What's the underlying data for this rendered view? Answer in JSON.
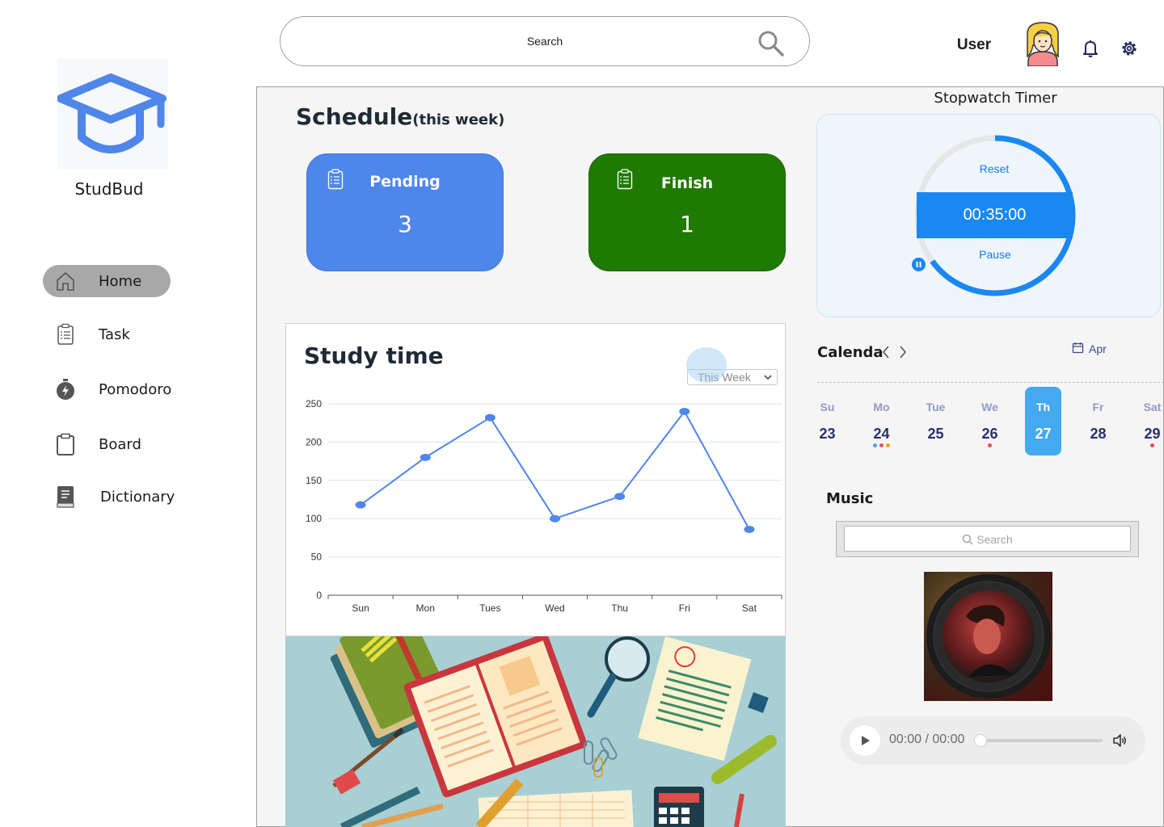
{
  "app": {
    "name": "StudBud"
  },
  "sidebar": {
    "items": [
      {
        "label": "Home",
        "icon": "home-icon",
        "active": true
      },
      {
        "label": "Task",
        "icon": "clipboard-icon"
      },
      {
        "label": "Pomodoro",
        "icon": "stopwatch-icon"
      },
      {
        "label": "Board",
        "icon": "board-icon"
      },
      {
        "label": "Dictionary",
        "icon": "book-icon"
      }
    ]
  },
  "header": {
    "search_placeholder": "Search",
    "user_name": "User"
  },
  "schedule": {
    "title": "Schedule",
    "subtitle": "(this week)",
    "pending": {
      "label": "Pending",
      "value": "3"
    },
    "finish": {
      "label": "Finish",
      "value": "1"
    }
  },
  "study_time": {
    "title": "Study time",
    "period_select": "This Week"
  },
  "chart_data": {
    "type": "line",
    "title": "Study time",
    "categories": [
      "Sun",
      "Mon",
      "Tues",
      "Wed",
      "Thu",
      "Fri",
      "Sat"
    ],
    "series": [
      {
        "values": [
          118,
          180,
          232,
          100,
          129,
          240,
          86
        ]
      }
    ],
    "ylim": [
      0,
      250
    ],
    "yticks": [
      0,
      50,
      100,
      150,
      200,
      250
    ],
    "grid": true,
    "color": "#4f86ea"
  },
  "stopwatch": {
    "title": "Stopwatch Timer",
    "reset_label": "Reset",
    "time": "00:35:00",
    "pause_label": "Pause",
    "progress": 0.65
  },
  "calendar": {
    "title": "Calenda",
    "month": "Apr",
    "days": [
      {
        "name": "Su",
        "num": "23",
        "dots": []
      },
      {
        "name": "Mo",
        "num": "24",
        "dots": [
          "#4fa3f0",
          "#e84c5a",
          "#f0a020"
        ]
      },
      {
        "name": "Tue",
        "num": "25",
        "dots": []
      },
      {
        "name": "We",
        "num": "26",
        "dots": [
          "#e84c5a"
        ]
      },
      {
        "name": "Th",
        "num": "27",
        "dots": [],
        "selected": true
      },
      {
        "name": "Fr",
        "num": "28",
        "dots": []
      },
      {
        "name": "Sat",
        "num": "29",
        "dots": [
          "#e84c5a"
        ]
      }
    ]
  },
  "music": {
    "title": "Music",
    "search_placeholder": "Search",
    "time": "00:00 / 00:00"
  },
  "colors": {
    "pending": "#4f86ea",
    "finish": "#1f7a00",
    "accent": "#1b87f0",
    "calendar_selected": "#44a9ef"
  }
}
